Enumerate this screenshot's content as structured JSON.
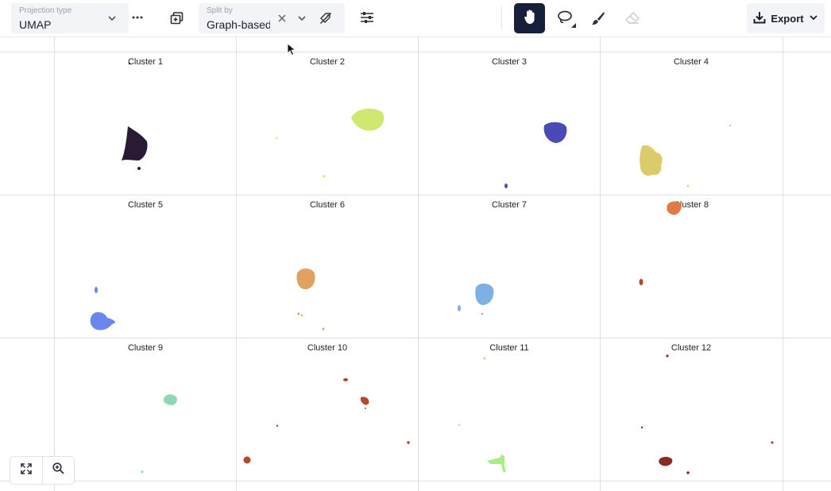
{
  "toolbar": {
    "projection": {
      "label": "Projection type",
      "value": "UMAP"
    },
    "split": {
      "label": "Split by",
      "value": "Graph-based"
    },
    "export_label": "Export"
  },
  "cells": [
    {
      "title": "Cluster 1",
      "color": "#2b1a33"
    },
    {
      "title": "Cluster 2",
      "color": "#cfe86f"
    },
    {
      "title": "Cluster 3",
      "color": "#4a49b8"
    },
    {
      "title": "Cluster 4",
      "color": "#dccb6a"
    },
    {
      "title": "Cluster 5",
      "color": "#6b86ee"
    },
    {
      "title": "Cluster 6",
      "color": "#e2a15f"
    },
    {
      "title": "Cluster 7",
      "color": "#7fb0e3"
    },
    {
      "title": "Cluster 8",
      "color": "#e07a45"
    },
    {
      "title": "Cluster 9",
      "color": "#8ed9b5"
    },
    {
      "title": "Cluster 10",
      "color": "#b5482a"
    },
    {
      "title": "Cluster 11",
      "color": "#a9ee82"
    },
    {
      "title": "Cluster 12",
      "color": "#8a2a22"
    }
  ]
}
